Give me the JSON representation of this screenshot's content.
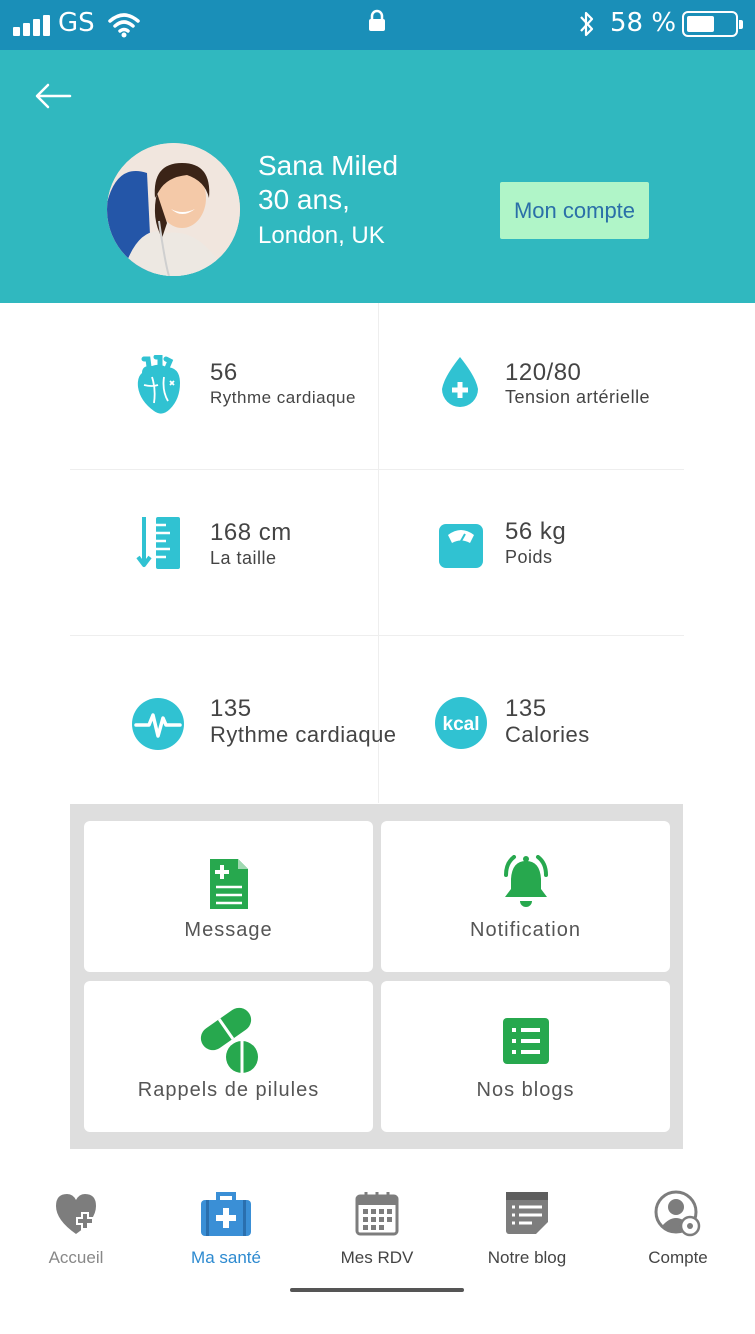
{
  "status_bar": {
    "carrier": "GS",
    "battery_text": "58 %",
    "battery_level": 0.58
  },
  "profile": {
    "name": "Sana Miled",
    "age": "30 ans,",
    "location": "London, UK",
    "account_button": "Mon compte"
  },
  "stats": [
    {
      "value": "56",
      "label": "Rythme cardiaque",
      "icon": "heart-organ-icon"
    },
    {
      "value": "120/80",
      "label": "Tension artérielle",
      "icon": "blood-drop-icon"
    },
    {
      "value": "168 cm",
      "label": "La taille",
      "icon": "ruler-icon"
    },
    {
      "value": "56 kg",
      "label": "Poids",
      "icon": "scale-icon"
    },
    {
      "value": "135",
      "label": "Rythme cardiaque",
      "icon": "heartbeat-pulse-icon"
    },
    {
      "value": "135",
      "label": "Calories",
      "icon": "kcal-icon",
      "icon_text": "kcal"
    }
  ],
  "tiles": [
    {
      "label": "Message",
      "icon": "medical-document-icon"
    },
    {
      "label": "Notification",
      "icon": "bell-icon"
    },
    {
      "label": "Rappels de pilules",
      "icon": "pills-icon"
    },
    {
      "label": "Nos blogs",
      "icon": "list-icon"
    }
  ],
  "nav": [
    {
      "label": "Accueil",
      "icon": "heart-plus-icon",
      "active": false
    },
    {
      "label": "Ma santé",
      "icon": "medical-kit-icon",
      "active": true
    },
    {
      "label": "Mes RDV",
      "icon": "calendar-icon",
      "active": false
    },
    {
      "label": "Notre blog",
      "icon": "blog-icon",
      "active": false
    },
    {
      "label": "Compte",
      "icon": "account-settings-icon",
      "active": false
    }
  ],
  "colors": {
    "status_bar": "#1a8fb8",
    "header": "#30b8bf",
    "accent_teal": "#30c2d2",
    "tile_green": "#27a84e",
    "account_button_bg": "#b0f5c8",
    "nav_active": "#2d8ad0"
  }
}
